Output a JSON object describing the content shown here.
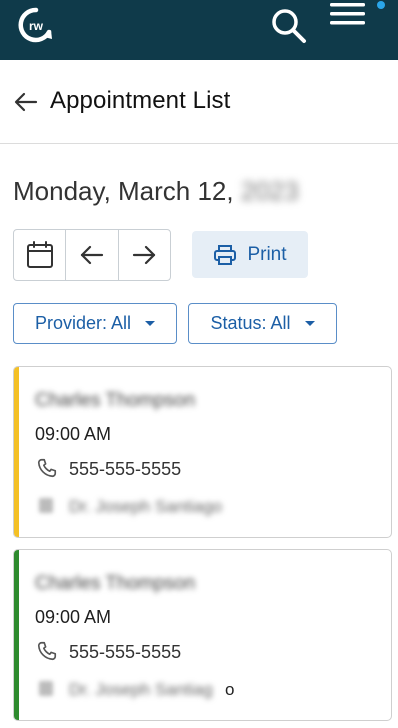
{
  "app": {
    "logo_text": "rw",
    "brand_color": "#0f3a4a",
    "notification_color": "#2aa6ea"
  },
  "header": {
    "title": "Appointment List"
  },
  "date": {
    "label": "Monday, March 12,",
    "year": "2023"
  },
  "toolbar": {
    "calendar_icon": "calendar-icon",
    "prev_icon": "arrow-left-icon",
    "next_icon": "arrow-right-icon",
    "print_label": "Print"
  },
  "filters": {
    "provider_label": "Provider: All",
    "status_label": "Status: All"
  },
  "appointments": [
    {
      "patient": "Charles Thompson",
      "time": "09:00 AM",
      "phone": "555-555-5555",
      "provider": "Dr. Joseph Santiago",
      "accent_color": "#f4c025"
    },
    {
      "patient": "Charles Thompson",
      "time": "09:00 AM",
      "phone": "555-555-5555",
      "provider": "Dr. Joseph Santiag",
      "provider_tail": "o",
      "accent_color": "#2e8b2e"
    }
  ]
}
